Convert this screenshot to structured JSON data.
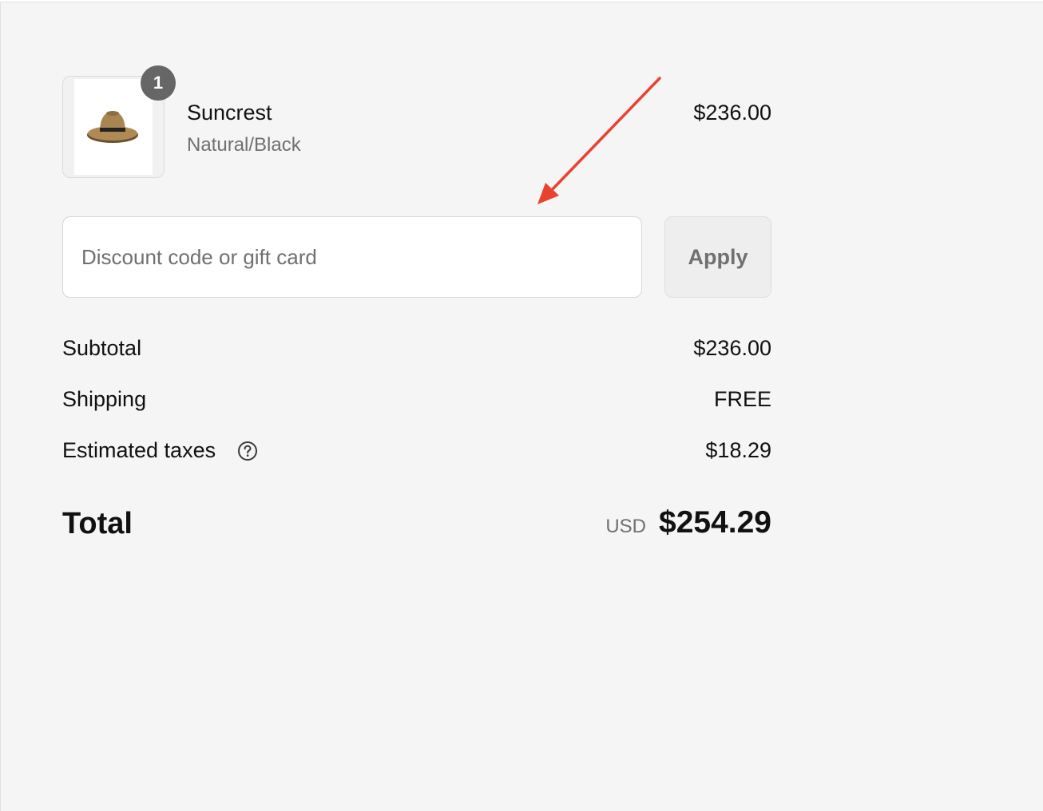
{
  "line_item": {
    "quantity": "1",
    "name": "Suncrest",
    "variant": "Natural/Black",
    "price": "$236.00",
    "image_icon": "hat-icon"
  },
  "discount": {
    "placeholder": "Discount code or gift card",
    "value": "",
    "apply_label": "Apply"
  },
  "summary": {
    "subtotal_label": "Subtotal",
    "subtotal_value": "$236.00",
    "shipping_label": "Shipping",
    "shipping_value": "FREE",
    "taxes_label": "Estimated taxes",
    "taxes_value": "$18.29",
    "taxes_help_icon": "question-circle-icon",
    "total_label": "Total",
    "currency": "USD",
    "total_value": "$254.29"
  },
  "annotation": {
    "arrow_color": "#e8432e",
    "icon": "arrow-icon"
  },
  "colors": {
    "background": "#f5f5f5",
    "badge": "#666666",
    "muted_text": "#707070"
  }
}
